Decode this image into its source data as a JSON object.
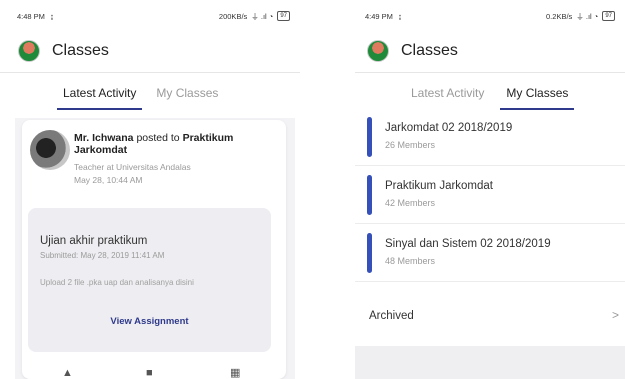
{
  "left_screen": {
    "status": {
      "time": "4:48 PM",
      "usb": "↨",
      "speed": "200KB/s",
      "battery": "97"
    },
    "app_title": "Classes",
    "tabs": [
      "Latest Activity",
      "My Classes"
    ],
    "active_tab": "Latest Activity",
    "post": {
      "author": "Mr. Ichwana",
      "action": " posted to ",
      "target": "Praktikum Jarkomdat",
      "role": "Teacher at Universitas Andalas",
      "time": "May 28, 10:44 AM",
      "assignment": {
        "title": "Ujian akhir praktikum",
        "submitted": "Submitted: May 28, 2019 11:41 AM",
        "description": "Upload 2 file .pka uap dan analisanya disini",
        "button": "View Assignment"
      }
    },
    "icons": [
      "thumbs-up-icon",
      "comment-icon",
      "calendar-icon"
    ]
  },
  "right_screen": {
    "status": {
      "time": "4:49 PM",
      "usb": "↨",
      "speed": "0.2KB/s",
      "battery": "97"
    },
    "app_title": "Classes",
    "tabs": [
      "Latest Activity",
      "My Classes"
    ],
    "active_tab": "My Classes",
    "classes": [
      {
        "name": "Jarkomdat 02 2018/2019",
        "members": "26 Members"
      },
      {
        "name": "Praktikum Jarkomdat",
        "members": "42 Members"
      },
      {
        "name": "Sinyal dan Sistem 02 2018/2019",
        "members": "48 Members"
      }
    ],
    "archived": "Archived",
    "archived_chevron": ">"
  },
  "colors": {
    "accent": "#2f3a8c",
    "class_bar": "#3550b8"
  }
}
